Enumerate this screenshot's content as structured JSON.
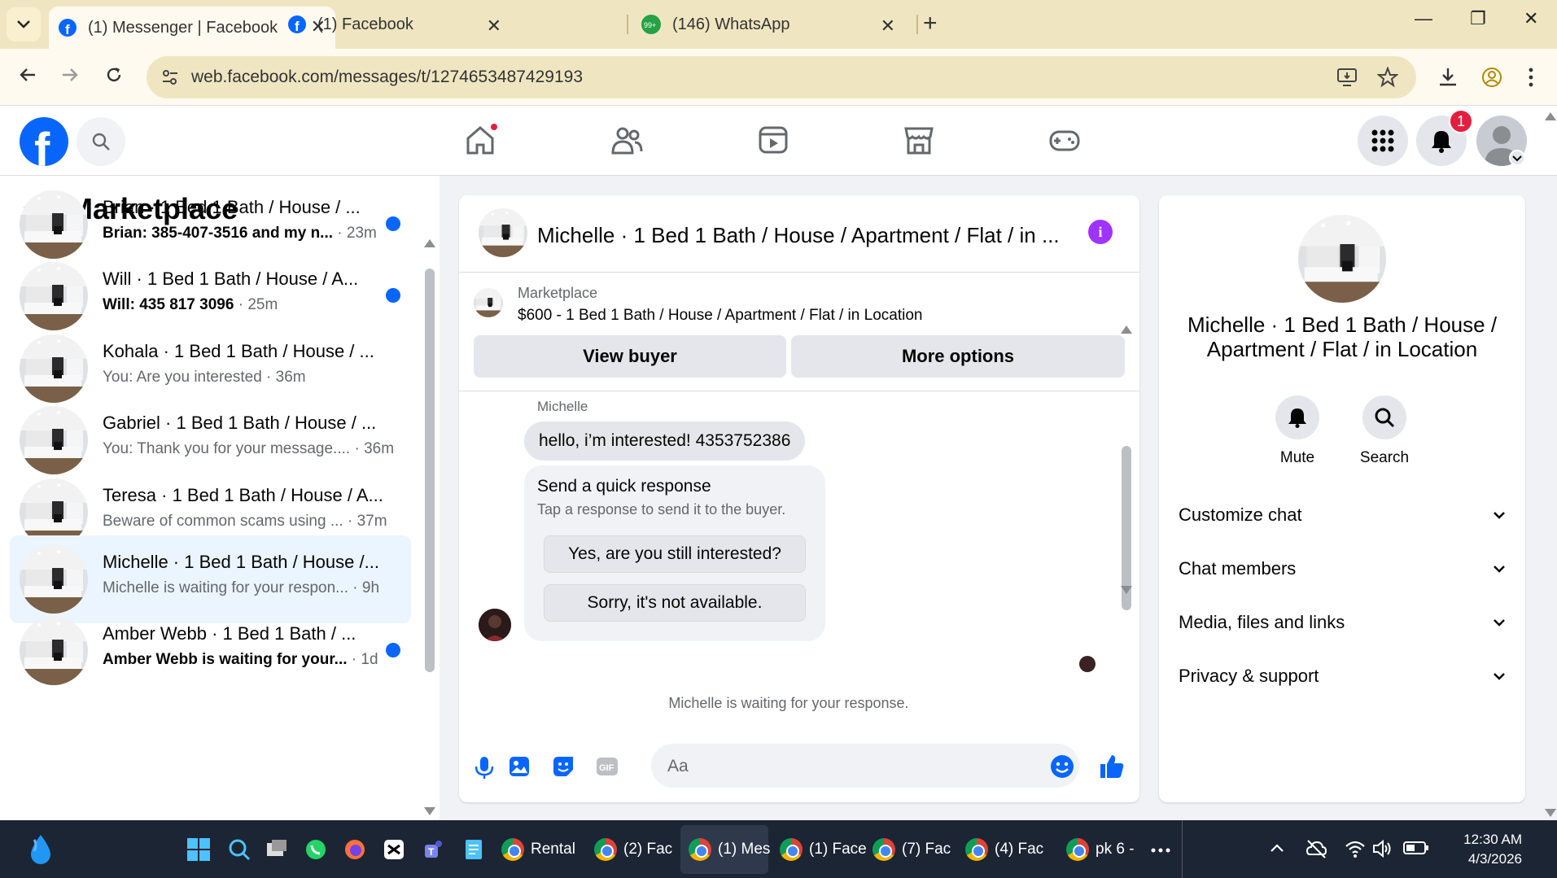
{
  "browser": {
    "tabs": [
      {
        "title": "(1) Messenger | Facebook",
        "active": true
      },
      {
        "title": "(1) Facebook",
        "active": false
      },
      {
        "title": "(146) WhatsApp",
        "active": false,
        "badge": "99+"
      }
    ],
    "url": "web.facebook.com/messages/t/1274653487429193"
  },
  "header": {
    "notification_count": "1"
  },
  "left_pane": {
    "title": "Marketplace",
    "conversations": [
      {
        "name": "Brian · 1 Bed 1 Bath / House / ...",
        "preview": "Brian: 385-407-3516 and my n...",
        "time": "23m",
        "unread": true
      },
      {
        "name": "Will · 1 Bed 1 Bath / House / A...",
        "preview": "Will: 435 817 3096",
        "time": "25m",
        "unread": true
      },
      {
        "name": "Kohala · 1 Bed 1 Bath / House / ...",
        "preview": "You: Are you interested",
        "time": "36m",
        "unread": false
      },
      {
        "name": "Gabriel · 1 Bed 1 Bath / House / ...",
        "preview": "You: Thank you for your message....",
        "time": "36m",
        "unread": false
      },
      {
        "name": "Teresa · 1 Bed 1 Bath / House / A...",
        "preview": "Beware of common scams using ...",
        "time": "37m",
        "unread": false
      },
      {
        "name": "Michelle · 1 Bed 1 Bath / House /...",
        "preview": "Michelle is waiting for your respon...",
        "time": "9h",
        "unread": false,
        "selected": true
      },
      {
        "name": "Amber Webb · 1 Bed 1 Bath / ...",
        "preview": "Amber Webb is waiting for your...",
        "time": "1d",
        "unread": true
      }
    ]
  },
  "chat": {
    "title": "Michelle · 1 Bed 1 Bath / House / Apartment / Flat / in ...",
    "marketplace_label": "Marketplace",
    "listing": "$600 - 1 Bed 1 Bath / House / Apartment / Flat / in Location",
    "view_buyer": "View buyer",
    "more_options": "More options",
    "sender": "Michelle",
    "message": "hello, i’m interested! 4353752386",
    "quick_response": {
      "title": "Send a quick response",
      "subtitle": "Tap a response to send it to the buyer.",
      "options": [
        "Yes, are you still interested?",
        "Sorry, it's not available."
      ]
    },
    "waiting_note": "Michelle is waiting for your response.",
    "composer_placeholder": "Aa"
  },
  "right_pane": {
    "name": "Michelle · 1 Bed 1 Bath / House / Apartment / Flat / in Location",
    "actions": [
      {
        "label": "Mute",
        "icon": "bell-icon"
      },
      {
        "label": "Search",
        "icon": "search-icon"
      }
    ],
    "sections": [
      "Customize chat",
      "Chat members",
      "Media, files and links",
      "Privacy & support"
    ]
  },
  "taskbar": {
    "apps": [
      {
        "label": "Rental"
      },
      {
        "label": "(2) Fac"
      },
      {
        "label": "(1) Mes",
        "active": true
      },
      {
        "label": "(1) Face"
      },
      {
        "label": "(7) Fac"
      },
      {
        "label": "(4) Fac"
      },
      {
        "label": "pk 6 -"
      }
    ],
    "time": "12:30 AM",
    "date": "4/3/2026"
  },
  "colors": {
    "fb_blue": "#0866ff",
    "notification_red": "#e41e3f",
    "info_purple": "#a033ff",
    "tabstrip": "#efe6c1"
  }
}
